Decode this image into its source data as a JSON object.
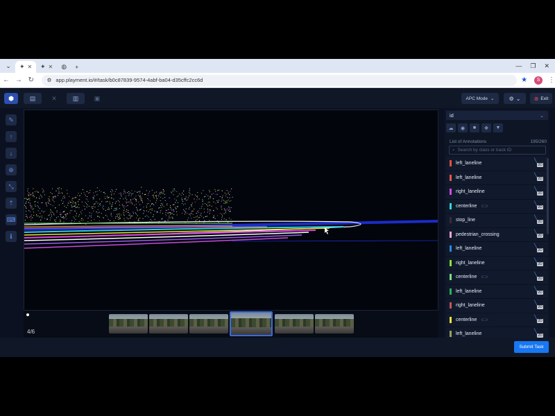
{
  "browser": {
    "tabs": [
      {
        "title": ""
      },
      {
        "title": ""
      },
      {
        "title": ""
      }
    ],
    "url": "app.playment.io/#/task/b0c87839-9574-4abf-ba04-d35cffc2cc6d",
    "avatar_letter": "S"
  },
  "toolbar": {
    "apc_mode_label": "APC Mode",
    "exit_label": "Exit"
  },
  "panel": {
    "id_select_value": "id",
    "list_title": "List of Annotations",
    "list_count": "195/260",
    "search_placeholder": "Search by class or track ID",
    "annotations": [
      {
        "label": "left_laneline",
        "color": "#e0523f",
        "linked": false
      },
      {
        "label": "left_laneline",
        "color": "#e8554a",
        "linked": false
      },
      {
        "label": "right_laneline",
        "color": "#d24ae0",
        "linked": false
      },
      {
        "label": "centerline",
        "color": "#35d6d6",
        "linked": true
      },
      {
        "label": "stop_line",
        "color": "#3a2a3a",
        "linked": false
      },
      {
        "label": "pedestrian_crossing",
        "color": "#f2a7cf",
        "linked": false
      },
      {
        "label": "left_laneline",
        "color": "#2a88e0",
        "linked": false
      },
      {
        "label": "right_laneline",
        "color": "#8ee03a",
        "linked": false
      },
      {
        "label": "centerline",
        "color": "#7be07a",
        "linked": true
      },
      {
        "label": "left_laneline",
        "color": "#2fb05a",
        "linked": false
      },
      {
        "label": "right_laneline",
        "color": "#c25858",
        "linked": false
      },
      {
        "label": "centerline",
        "color": "#f0e23a",
        "linked": true
      },
      {
        "label": "left_laneline",
        "color": "#9aa05a",
        "linked": false
      }
    ]
  },
  "viewer": {
    "frame_counter": "4/6",
    "active_frame_index": 3
  },
  "footer": {
    "submit_label": "Submit Task"
  }
}
